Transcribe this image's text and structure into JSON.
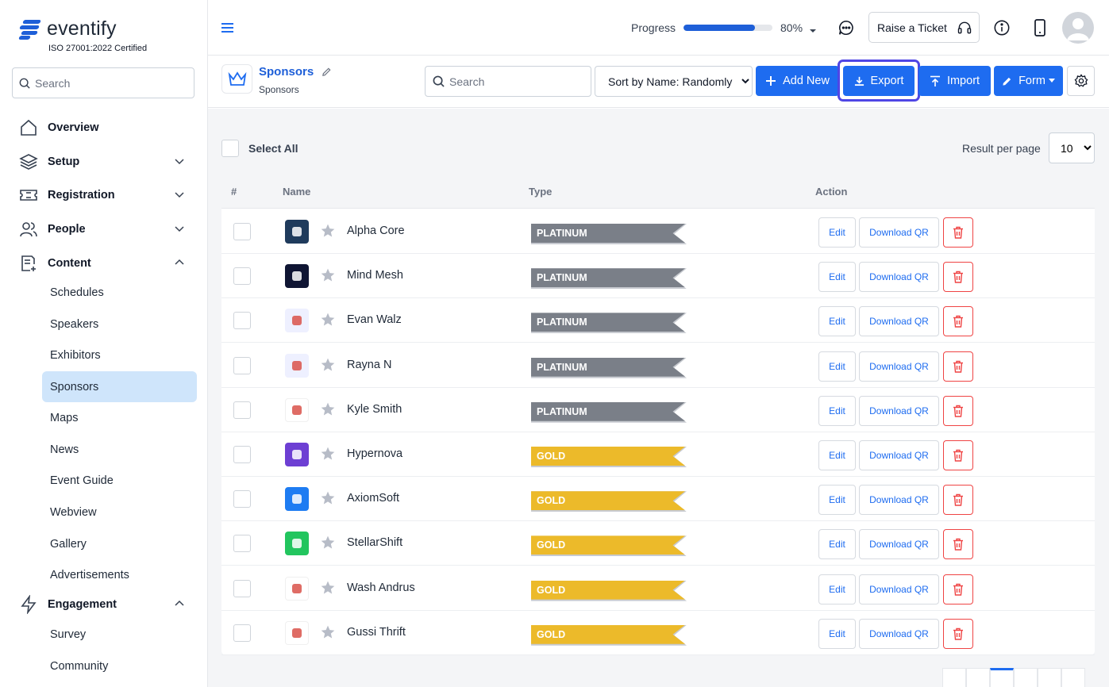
{
  "brand": {
    "name": "eventify",
    "certification": "ISO 27001:2022 Certified"
  },
  "sidebar": {
    "search_placeholder": "Search",
    "items": [
      {
        "label": "Overview",
        "icon": "home-icon"
      },
      {
        "label": "Setup",
        "icon": "layers-icon"
      },
      {
        "label": "Registration",
        "icon": "ticket-icon"
      },
      {
        "label": "People",
        "icon": "users-icon"
      },
      {
        "label": "Content",
        "icon": "file-plus-icon"
      },
      {
        "label": "Engagement",
        "icon": "lightning-icon"
      }
    ],
    "content_sub": [
      "Schedules",
      "Speakers",
      "Exhibitors",
      "Sponsors",
      "Maps",
      "News",
      "Event Guide",
      "Webview",
      "Gallery",
      "Advertisements"
    ],
    "engagement_sub": [
      "Survey",
      "Community"
    ],
    "active_item": "Sponsors"
  },
  "topbar": {
    "progress_label": "Progress",
    "progress_value": 80,
    "progress_text": "80%",
    "ticket_label": "Raise a Ticket"
  },
  "page": {
    "title": "Sponsors",
    "subtitle": "Sponsors",
    "search_placeholder": "Search",
    "sort_value": "Sort by Name: Randomly",
    "add_label": "Add New",
    "export_label": "Export",
    "import_label": "Import",
    "form_label": "Form"
  },
  "list": {
    "select_all": "Select All",
    "rpp_label": "Result per page",
    "rpp_value": "10",
    "columns": {
      "num": "#",
      "name": "Name",
      "type": "Type",
      "action": "Action"
    },
    "edit_label": "Edit",
    "qr_label": "Download QR",
    "rows": [
      {
        "name": "Alpha Core",
        "type": "PLATINUM",
        "logo_color": "#1f3b5c"
      },
      {
        "name": "Mind Mesh",
        "type": "PLATINUM",
        "logo_color": "#0f1533"
      },
      {
        "name": "Evan Walz",
        "type": "PLATINUM",
        "logo_color": "#eef0ff"
      },
      {
        "name": "Rayna N",
        "type": "PLATINUM",
        "logo_color": "#eef0ff"
      },
      {
        "name": "Kyle Smith",
        "type": "PLATINUM",
        "logo_color": "#ffffff"
      },
      {
        "name": "Hypernova",
        "type": "GOLD",
        "logo_color": "#6d3fd3"
      },
      {
        "name": "AxiomSoft",
        "type": "GOLD",
        "logo_color": "#1e7cf2"
      },
      {
        "name": "StellarShift",
        "type": "GOLD",
        "logo_color": "#22c55e"
      },
      {
        "name": "Wash Andrus",
        "type": "GOLD",
        "logo_color": "#ffffff"
      },
      {
        "name": "Gussi Thrift",
        "type": "GOLD",
        "logo_color": "#ffffff"
      }
    ]
  },
  "colors": {
    "accent": "#1e6cf0",
    "active_bg": "#cfe5fb",
    "focus_ring": "#4f46e5",
    "platinum": "#7a7f88",
    "gold": "#ecba2a",
    "danger": "#ef4444"
  }
}
